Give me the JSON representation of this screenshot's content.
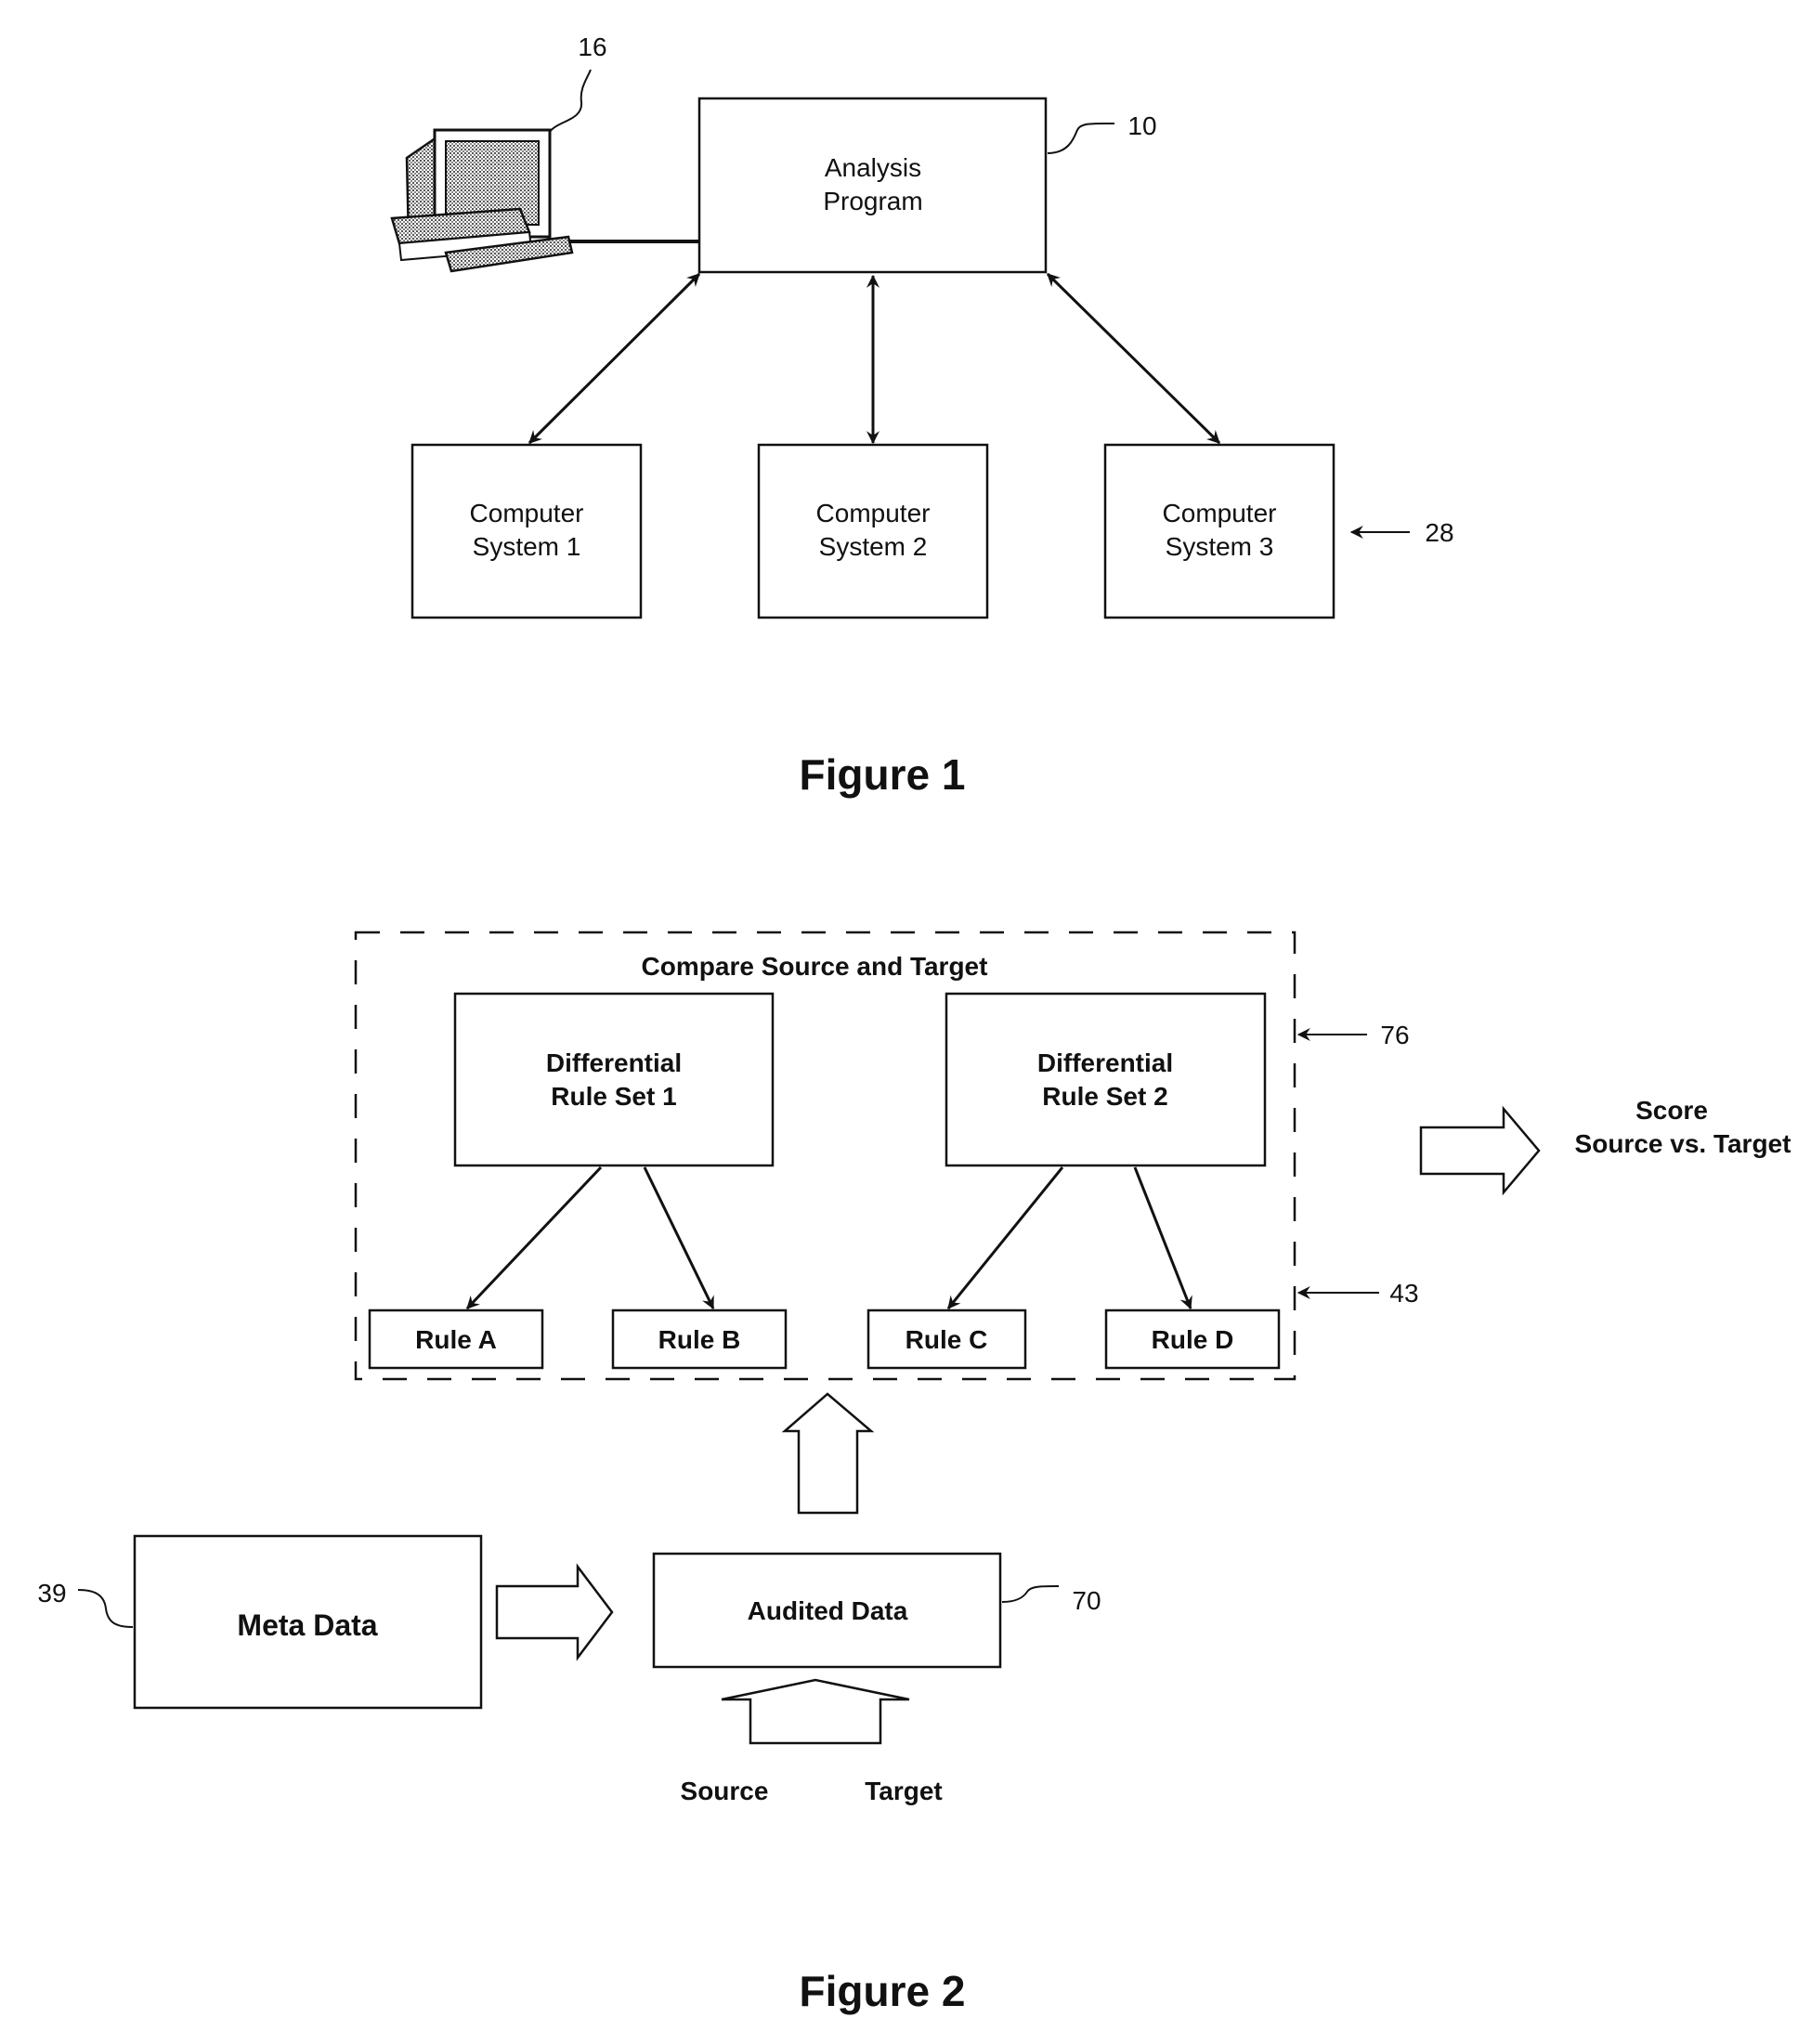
{
  "figure1": {
    "caption": "Figure 1",
    "analysis_program": {
      "line1": "Analysis",
      "line2": "Program",
      "ref": "10"
    },
    "workstation": {
      "icon": "desktop-computer-icon",
      "ref": "16"
    },
    "computer_systems": [
      {
        "line1": "Computer",
        "line2": "System 1"
      },
      {
        "line1": "Computer",
        "line2": "System 2"
      },
      {
        "line1": "Computer",
        "line2": "System 3"
      }
    ],
    "systems_ref": "28"
  },
  "figure2": {
    "caption": "Figure 2",
    "compare_group": {
      "title": "Compare Source and Target",
      "ref_outer": "76",
      "ref_rules": "43"
    },
    "rule_sets": [
      {
        "line1": "Differential",
        "line2": "Rule Set 1"
      },
      {
        "line1": "Differential",
        "line2": "Rule Set 2"
      }
    ],
    "rules": [
      "Rule A",
      "Rule B",
      "Rule C",
      "Rule D"
    ],
    "score": {
      "line1": "Score",
      "line2": "Source vs. Target"
    },
    "meta_data": {
      "label": "Meta Data",
      "ref": "39"
    },
    "audited_data": {
      "label": "Audited Data",
      "ref": "70"
    },
    "inputs": {
      "source": "Source",
      "target": "Target"
    }
  }
}
